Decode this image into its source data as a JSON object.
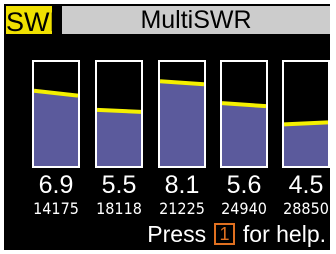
{
  "tabs": {
    "active_label": "SWR",
    "title": "MultiSWR"
  },
  "bands": [
    {
      "value": "6.9",
      "freq": "14175",
      "level": 0.7
    },
    {
      "value": "5.5",
      "freq": "18118",
      "level": 0.53
    },
    {
      "value": "8.1",
      "freq": "21225",
      "level": 0.8
    },
    {
      "value": "5.6",
      "freq": "24940",
      "level": 0.59
    },
    {
      "value": "4.5",
      "freq": "28850",
      "level": 0.41
    }
  ],
  "help": {
    "prefix": "Press",
    "key": "1",
    "suffix": "for help."
  },
  "colors": {
    "fill": "#5b5a9c",
    "line": "#f5f000",
    "border": "#ffffff",
    "key": "#e07020"
  }
}
